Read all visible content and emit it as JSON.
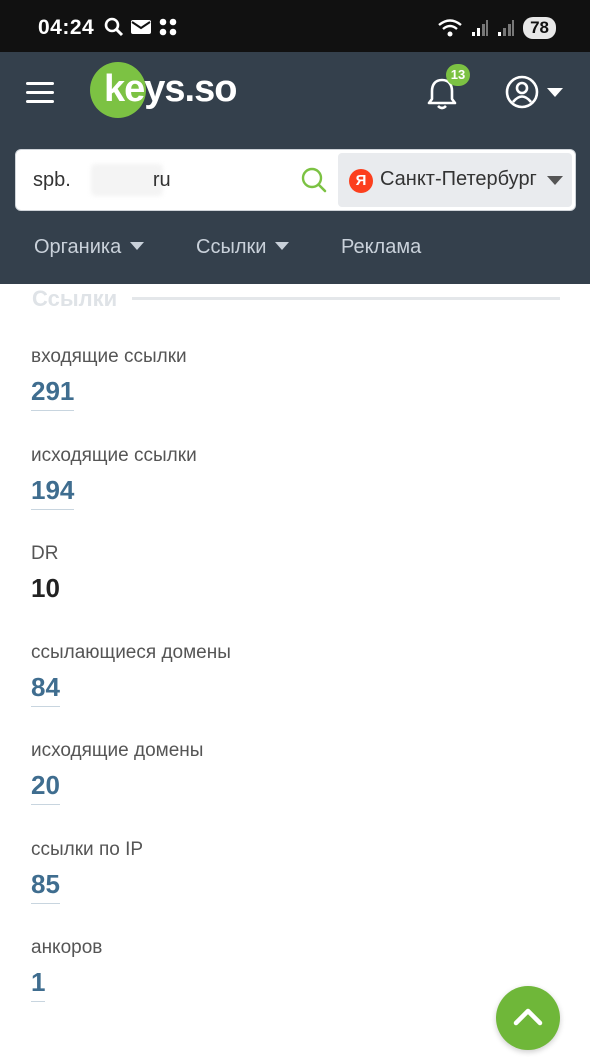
{
  "status_bar": {
    "time": "04:24",
    "battery": "78"
  },
  "header": {
    "logo_text": "keys.so",
    "notifications_count": "13",
    "search": {
      "value_prefix": "spb.",
      "value_suffix": "ru"
    },
    "region": {
      "engine_icon": "Я",
      "label": "Санкт-Петербург"
    },
    "nav": [
      {
        "label": "Органика",
        "has_dropdown": true
      },
      {
        "label": "Ссылки",
        "has_dropdown": true
      },
      {
        "label": "Реклама",
        "has_dropdown": false
      }
    ]
  },
  "section": {
    "title": "Ссылки",
    "metrics": [
      {
        "label": "входящие ссылки",
        "value": "291",
        "link": true
      },
      {
        "label": "исходящие ссылки",
        "value": "194",
        "link": true
      },
      {
        "label": "DR",
        "value": "10",
        "link": false
      },
      {
        "label": "ссылающиеся домены",
        "value": "84",
        "link": true
      },
      {
        "label": "исходящие домены",
        "value": "20",
        "link": true
      },
      {
        "label": "ссылки по IP",
        "value": "85",
        "link": true
      },
      {
        "label": "анкоров",
        "value": "1",
        "link": true
      }
    ]
  },
  "colors": {
    "header_bg": "#34404c",
    "brand_green": "#7cc243",
    "link_value": "#3f6d8f"
  }
}
